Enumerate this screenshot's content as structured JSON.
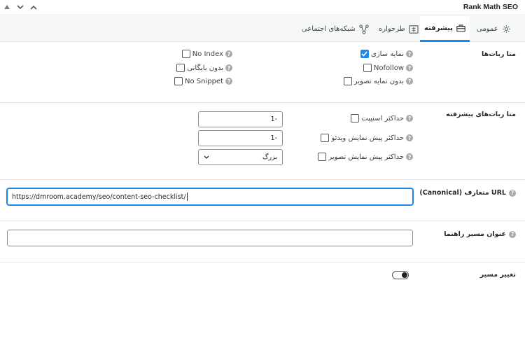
{
  "header": {
    "title": "Rank Math SEO",
    "arrows": [
      "up-triangle-icon",
      "chevron-down-icon",
      "chevron-up-icon"
    ]
  },
  "tabs": [
    {
      "label": "عمومی",
      "icon": "gear-icon",
      "active": false
    },
    {
      "label": "پیشرفته",
      "icon": "toolbox-icon",
      "active": true
    },
    {
      "label": "طرحواره",
      "icon": "schema-icon",
      "active": false
    },
    {
      "label": "شبکه‌های اجتماعی",
      "icon": "share-nodes-icon",
      "active": false
    }
  ],
  "robots_meta": {
    "label": "متا ربات‌ها",
    "options": {
      "index": {
        "label": "نمایه سازی",
        "checked": true
      },
      "nofollow": {
        "label": "Nofollow",
        "checked": false
      },
      "noimageindex": {
        "label": "بدون نمایه تصویر",
        "checked": false
      },
      "noindex": {
        "label": "No Index",
        "checked": false
      },
      "noarchive": {
        "label": "بدون بایگانی",
        "checked": false
      },
      "nosnippet": {
        "label": "No Snippet",
        "checked": false
      }
    }
  },
  "advanced_robots": {
    "label": "متا ربات‌های پیشرفته",
    "max_snippet": {
      "label": "حداکثر اسنیپت",
      "checked": false,
      "value": "-1"
    },
    "max_video_preview": {
      "label": "حداکثر پیش نمایش ویدئو",
      "checked": false,
      "value": "-1"
    },
    "max_image_preview": {
      "label": "حداکثر پیش نمایش تصویر",
      "checked": false,
      "value": "بزرگ"
    }
  },
  "canonical": {
    "label": "URL متعارف (Canonical)",
    "value": "https://dmroom.academy/seo/content-seo-checklist/"
  },
  "breadcrumb_title": {
    "label": "عنوان مسیر راهنما",
    "value": ""
  },
  "redirect": {
    "label": "تغییر مسیر",
    "enabled": false
  },
  "help_glyph": "?"
}
